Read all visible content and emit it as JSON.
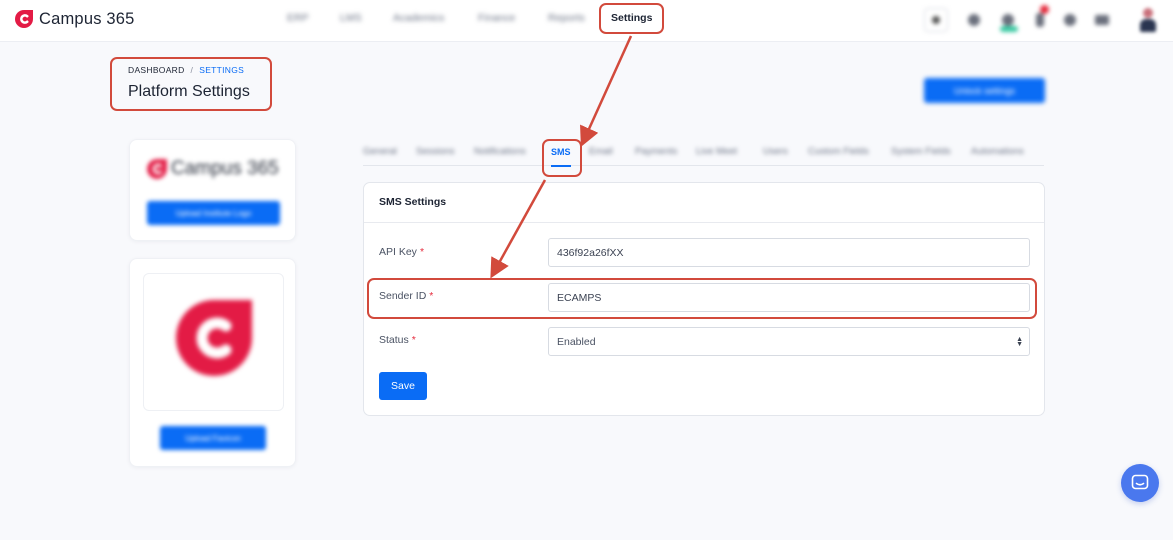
{
  "brand": {
    "name": "Campus 365",
    "color": "#e31b45"
  },
  "nav": {
    "items": [
      {
        "label": "ERP",
        "blurred": true
      },
      {
        "label": "LMS",
        "blurred": true
      },
      {
        "label": "Academics",
        "blurred": true
      },
      {
        "label": "Finance",
        "blurred": true
      },
      {
        "label": "Reports",
        "blurred": true
      },
      {
        "label": "Settings",
        "blurred": false,
        "active": true
      }
    ]
  },
  "topbar_icons": [
    "search-icon",
    "globe-icon",
    "user-status-icon",
    "notification-bell-icon",
    "settings-icon",
    "flag-icon",
    "user-avatar"
  ],
  "breadcrumb": {
    "root": "DASHBOARD",
    "separator": "/",
    "current": "SETTINGS"
  },
  "page": {
    "title": "Platform Settings",
    "action_button": "Unlock settings"
  },
  "left_panel": {
    "logo_text": "Campus 365",
    "upload_logo_button": "Upload Institute Logo",
    "upload_favicon_button": "Upload Favicon"
  },
  "tabs": [
    {
      "label": "General",
      "blurred": true
    },
    {
      "label": "Sessions",
      "blurred": true
    },
    {
      "label": "Notifications",
      "blurred": true
    },
    {
      "label": "SMS",
      "blurred": false,
      "active": true
    },
    {
      "label": "Email",
      "blurred": true
    },
    {
      "label": "Payments",
      "blurred": true
    },
    {
      "label": "Live Meet",
      "blurred": true
    },
    {
      "label": "Users",
      "blurred": true
    },
    {
      "label": "Custom Fields",
      "blurred": true
    },
    {
      "label": "System Fields",
      "blurred": true
    },
    {
      "label": "Automations",
      "blurred": true
    }
  ],
  "sms_form": {
    "title": "SMS Settings",
    "api_key": {
      "label": "API Key",
      "required": "*",
      "value": "436f92a26fXX"
    },
    "sender_id": {
      "label": "Sender ID",
      "required": "*",
      "value": "ECAMPS"
    },
    "status": {
      "label": "Status",
      "required": "*",
      "value": "Enabled"
    },
    "save_label": "Save"
  },
  "colors": {
    "accent": "#0a6cf5",
    "annotation": "#d24a3c",
    "required": "#e52b3d"
  }
}
